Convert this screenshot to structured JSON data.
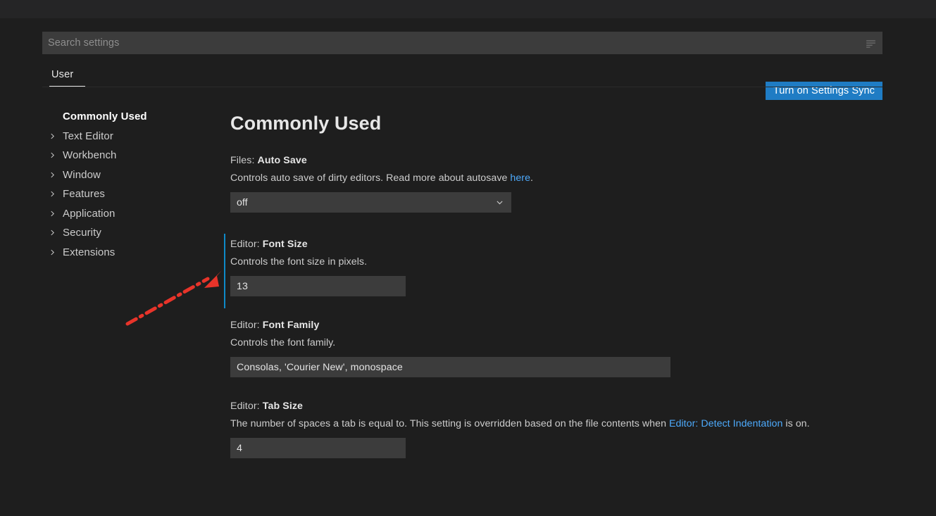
{
  "search": {
    "placeholder": "Search settings",
    "value": "",
    "filter_icon": "filter-icon"
  },
  "tabs": [
    {
      "label": "User",
      "selected": true
    }
  ],
  "actions": {
    "settings_sync_label": "Turn on Settings Sync",
    "accent_color": "#1f7cc4"
  },
  "toc": {
    "items": [
      {
        "label": "Commonly Used",
        "expandable": false,
        "selected": true
      },
      {
        "label": "Text Editor",
        "expandable": true,
        "selected": false
      },
      {
        "label": "Workbench",
        "expandable": true,
        "selected": false
      },
      {
        "label": "Window",
        "expandable": true,
        "selected": false
      },
      {
        "label": "Features",
        "expandable": true,
        "selected": false
      },
      {
        "label": "Application",
        "expandable": true,
        "selected": false
      },
      {
        "label": "Security",
        "expandable": true,
        "selected": false
      },
      {
        "label": "Extensions",
        "expandable": true,
        "selected": false
      }
    ]
  },
  "main": {
    "title": "Commonly Used",
    "settings": [
      {
        "category": "Files: ",
        "name": "Auto Save",
        "desc_before": "Controls auto save of dirty editors. Read more about autosave ",
        "link": "here",
        "desc_after": ".",
        "control": "select",
        "value": "off",
        "focused": false
      },
      {
        "category": "Editor: ",
        "name": "Font Size",
        "desc_before": "Controls the font size in pixels.",
        "link": "",
        "desc_after": "",
        "control": "number",
        "value": "13",
        "focused": true
      },
      {
        "category": "Editor: ",
        "name": "Font Family",
        "desc_before": "Controls the font family.",
        "link": "",
        "desc_after": "",
        "control": "text",
        "value": "Consolas, 'Courier New', monospace",
        "focused": false
      },
      {
        "category": "Editor: ",
        "name": "Tab Size",
        "desc_before": "The number of spaces a tab is equal to. This setting is overridden based on the file contents when ",
        "link": "Editor: Detect Indentation",
        "desc_after": " is on.",
        "control": "number",
        "value": "4",
        "focused": false
      }
    ]
  },
  "annotation": {
    "type": "arrow",
    "color": "#e8342a",
    "style": "dash-dot",
    "points_to": "font-size-setting-focus-indicator"
  }
}
